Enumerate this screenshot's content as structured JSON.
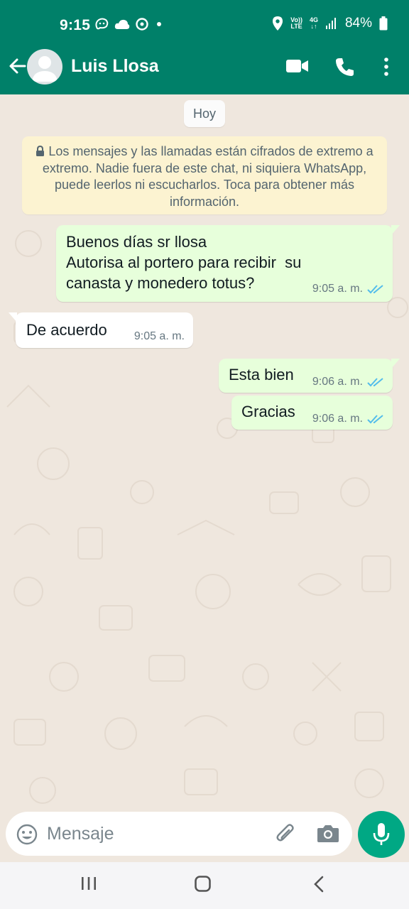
{
  "status_bar": {
    "time": "9:15",
    "volte_line1": "Vo))",
    "volte_line2": "LTE",
    "network_line1": "4G",
    "network_line2": "↓↑",
    "battery_percent": "84%"
  },
  "header": {
    "contact_name": "Luis Llosa",
    "icons": [
      "back-arrow-icon",
      "avatar",
      "video-call-icon",
      "voice-call-icon",
      "more-options-icon"
    ]
  },
  "chat": {
    "date_chip": "Hoy",
    "encryption_notice": "Los mensajes y las llamadas están cifrados de extremo a extremo. Nadie fuera de este chat, ni siquiera WhatsApp, puede leerlos ni escucharlos. Toca para obtener más información.",
    "messages": [
      {
        "direction": "outgoing",
        "lines": [
          "Buenos días sr llosa",
          "Autorisa al portero para recibir  su",
          "canasta y monedero totus?"
        ],
        "time": "9:05 a. m.",
        "status": "read"
      },
      {
        "direction": "incoming",
        "text": "De acuerdo",
        "time": "9:05 a. m."
      },
      {
        "direction": "outgoing",
        "text": "Esta bien",
        "time": "9:06 a. m.",
        "status": "read"
      },
      {
        "direction": "outgoing",
        "text": "Gracias",
        "time": "9:06 a. m.",
        "status": "read"
      }
    ]
  },
  "input": {
    "placeholder": "Mensaje",
    "value": ""
  },
  "colors": {
    "header": "#008069",
    "outgoing_bubble": "#e7ffdb",
    "incoming_bubble": "#ffffff",
    "notice_bubble": "#fcf3d1",
    "mic_button": "#00a884",
    "read_ticks": "#53bdeb"
  }
}
